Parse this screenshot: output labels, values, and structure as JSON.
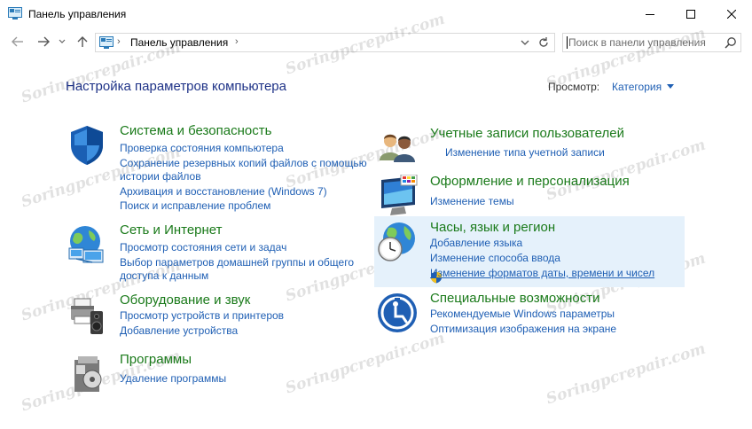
{
  "window": {
    "title": "Панель управления"
  },
  "address": {
    "path": "Панель управления"
  },
  "search": {
    "placeholder": "Поиск в панели управления"
  },
  "header": {
    "title": "Настройка параметров компьютера",
    "view_label": "Просмотр:",
    "view_value": "Категория"
  },
  "watermark": "Soringpcrepair.com",
  "categories": {
    "system": {
      "title": "Система и безопасность",
      "links": [
        "Проверка состояния компьютера",
        "Сохранение резервных копий файлов с помощью",
        "истории файлов",
        "Архивация и восстановление (Windows 7)",
        "Поиск и исправление проблем"
      ]
    },
    "network": {
      "title": "Сеть и Интернет",
      "links": [
        "Просмотр состояния сети и задач",
        "Выбор параметров домашней группы и общего",
        "доступа к данным"
      ]
    },
    "hardware": {
      "title": "Оборудование и звук",
      "links": [
        "Просмотр устройств и принтеров",
        "Добавление устройства"
      ]
    },
    "programs": {
      "title": "Программы",
      "links": [
        "Удаление программы"
      ]
    },
    "users": {
      "title": "Учетные записи пользователей",
      "links": [
        "Изменение типа учетной записи"
      ]
    },
    "appearance": {
      "title": "Оформление и персонализация",
      "links": [
        "Изменение темы"
      ]
    },
    "clock": {
      "title": "Часы, язык и регион",
      "links": [
        "Добавление языка",
        "Изменение способа ввода",
        "Изменение форматов даты, времени и чисел"
      ]
    },
    "ease": {
      "title": "Специальные возможности",
      "links": [
        "Рекомендуемые Windows параметры",
        "Оптимизация изображения на экране"
      ]
    }
  }
}
